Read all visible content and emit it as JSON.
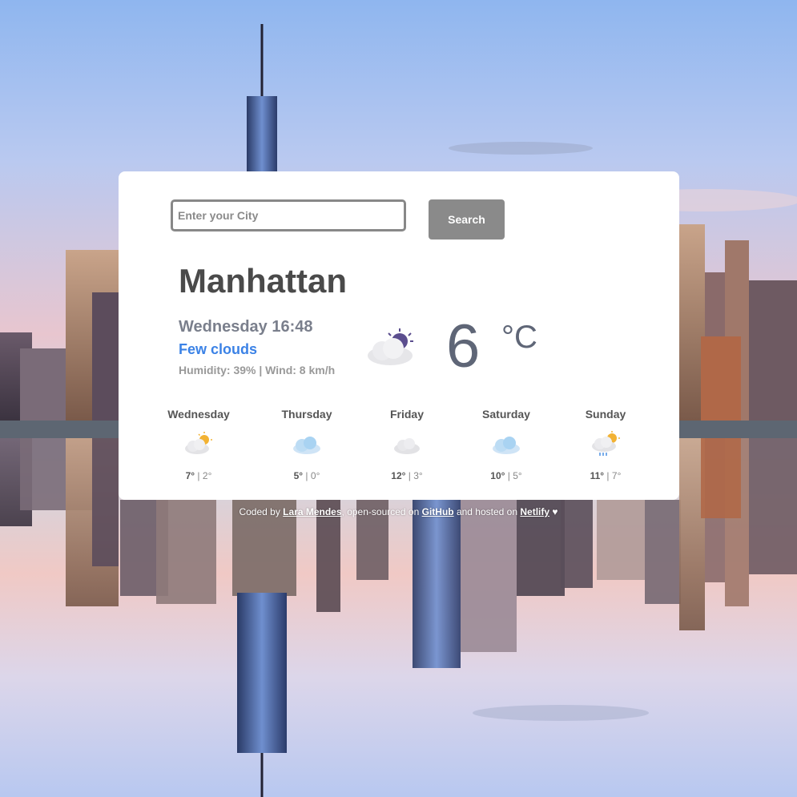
{
  "search": {
    "placeholder": "Enter your City",
    "value": "",
    "button_label": "Search"
  },
  "current": {
    "city": "Manhattan",
    "datetime": "Wednesday 16:48",
    "description": "Few clouds",
    "details": "Humidity: 39% | Wind: 8 km/h",
    "temperature": "6",
    "unit": "°C",
    "icon": "few-clouds-night-icon"
  },
  "forecast": [
    {
      "day": "Wednesday",
      "max": "7°",
      "min": "2°",
      "icon": "partly-cloudy-icon"
    },
    {
      "day": "Thursday",
      "max": "5°",
      "min": "0°",
      "icon": "cloudy-icon"
    },
    {
      "day": "Friday",
      "max": "12°",
      "min": "3°",
      "icon": "cloud-icon"
    },
    {
      "day": "Saturday",
      "max": "10°",
      "min": "5°",
      "icon": "cloudy-icon"
    },
    {
      "day": "Sunday",
      "max": "11°",
      "min": "7°",
      "icon": "rain-sun-icon"
    }
  ],
  "footer": {
    "prefix": "Coded by",
    "author": "Lara Mendes",
    "mid1": ", open-sourced on",
    "repo": "GitHub",
    "mid2": "and hosted on",
    "host": "Netlify",
    "heart": "♥"
  }
}
